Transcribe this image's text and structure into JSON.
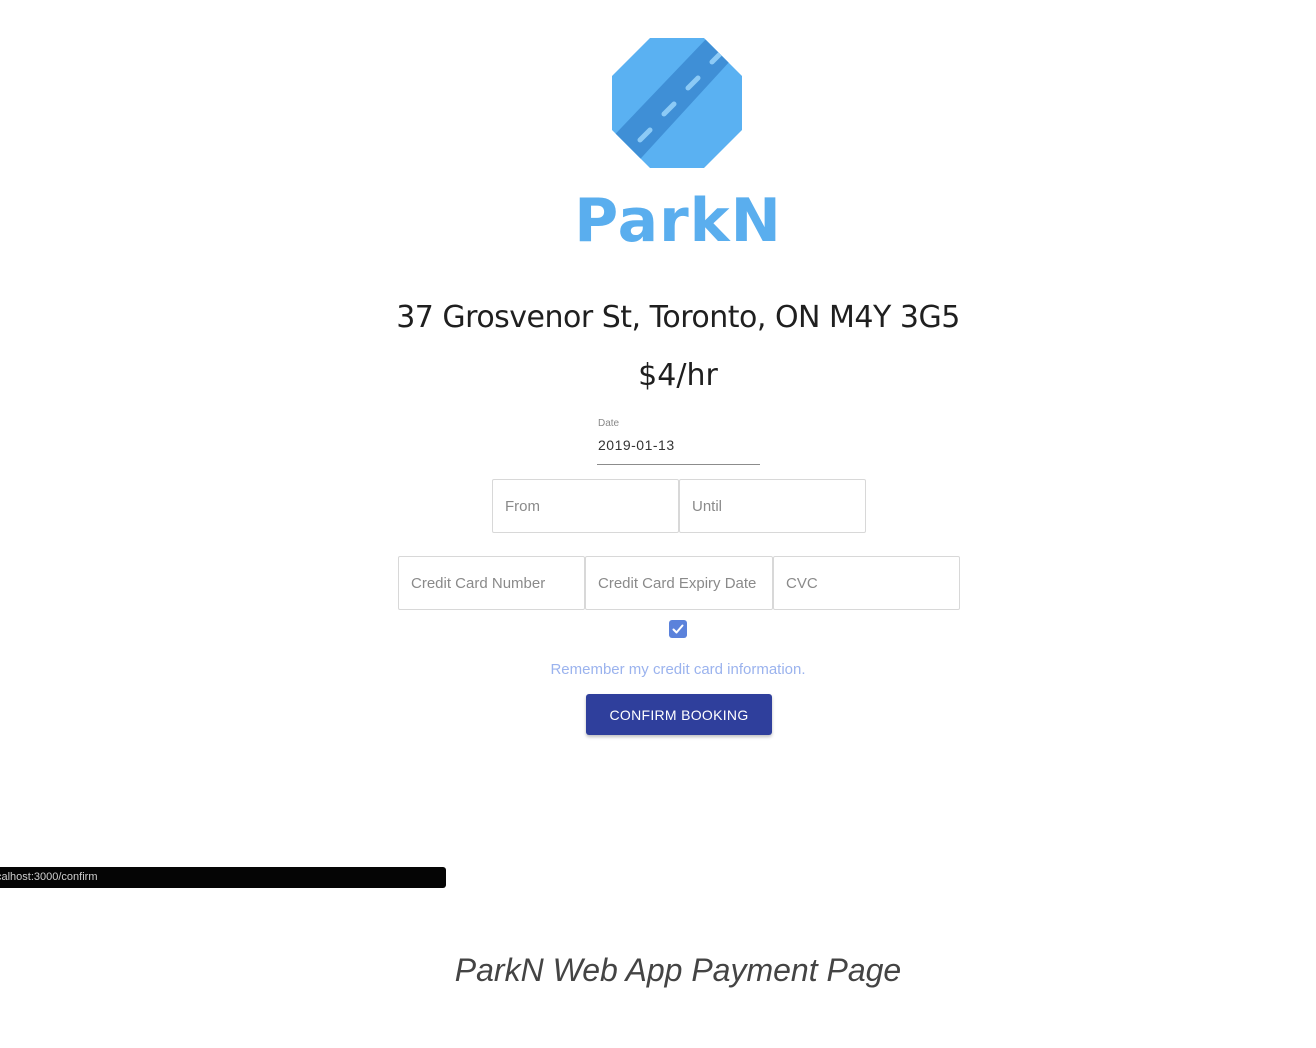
{
  "brand": {
    "name": "ParkN",
    "logo_icon": "road-octagon-icon",
    "color": "#5aaeee"
  },
  "listing": {
    "address": "37 Grosvenor St, Toronto, ON M4Y 3G5",
    "price": "$4/hr"
  },
  "form": {
    "date_label": "Date",
    "date_value": "2019-01-13",
    "from_placeholder": "From",
    "until_placeholder": "Until",
    "card_number_placeholder": "Credit Card Number",
    "card_expiry_placeholder": "Credit Card Expiry Date",
    "cvc_placeholder": "CVC",
    "remember_checked": true,
    "remember_label": "Remember my credit card information.",
    "confirm_label": "CONFIRM BOOKING",
    "accent": "#2f3f9c"
  },
  "status_bar": {
    "url": "calhost:3000/confirm"
  },
  "caption": "ParkN Web App Payment Page"
}
